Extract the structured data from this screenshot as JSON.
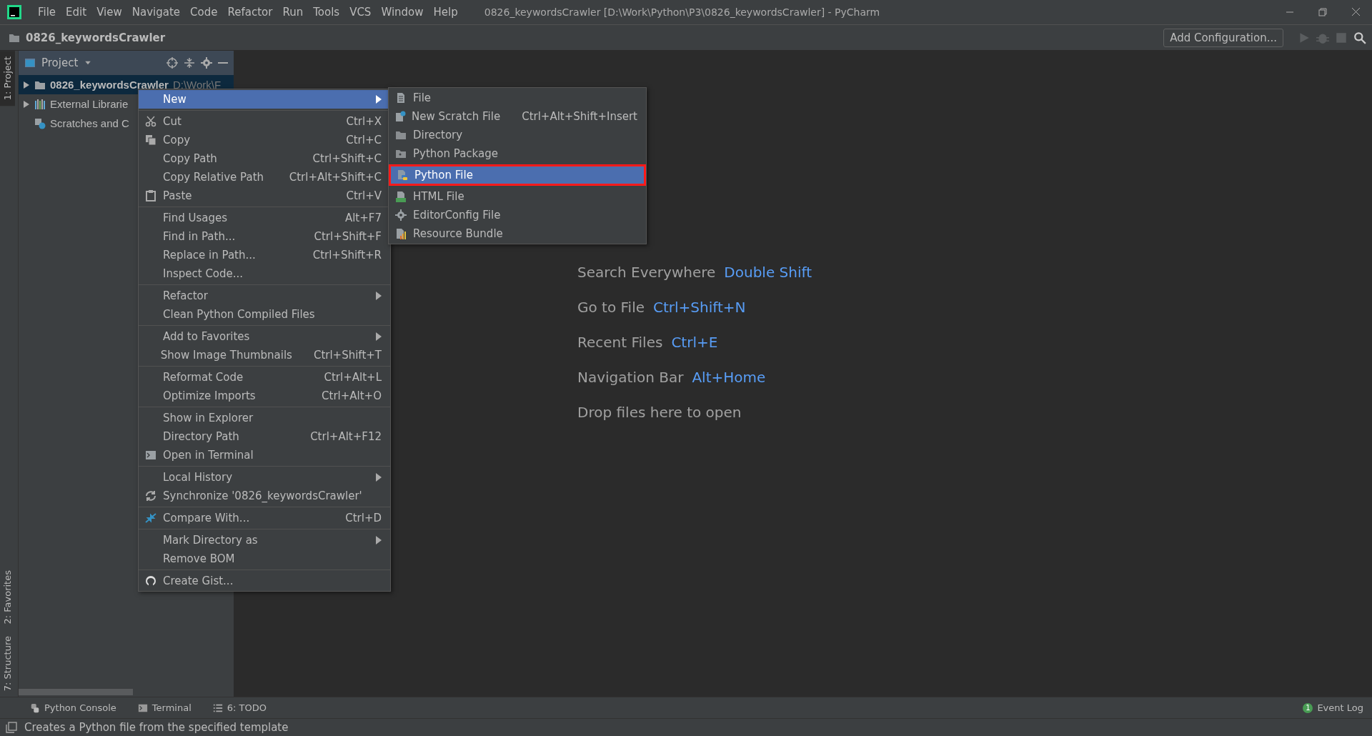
{
  "window": {
    "title": "0826_keywordsCrawler [D:\\Work\\Python\\P3\\0826_keywordsCrawler] - PyCharm"
  },
  "menu_bar": [
    "File",
    "Edit",
    "View",
    "Navigate",
    "Code",
    "Refactor",
    "Run",
    "Tools",
    "VCS",
    "Window",
    "Help"
  ],
  "navigation_bar": {
    "breadcrumb": "0826_keywordsCrawler",
    "run_config": "Add Configuration..."
  },
  "left_tool_strip": [
    {
      "label": "1: Project",
      "selected": true
    },
    {
      "label": "2: Favorites",
      "selected": false
    },
    {
      "label": "7: Structure",
      "selected": false
    }
  ],
  "project_panel": {
    "title": "Project",
    "tree": [
      {
        "label": "0826_keywordsCrawler",
        "path": "D:\\Work\\F",
        "expanded": false,
        "selected": true
      },
      {
        "label": "External Librarie",
        "expanded": false,
        "selected": false
      },
      {
        "label": "Scratches and C",
        "selected": false
      }
    ]
  },
  "context_menu": [
    [
      {
        "label": "New",
        "submenu": true,
        "selected": true
      }
    ],
    [
      {
        "label": "Cut",
        "shortcut": "Ctrl+X",
        "selected": false
      },
      {
        "label": "Copy",
        "shortcut": "Ctrl+C",
        "selected": false
      },
      {
        "label": "Copy Path",
        "shortcut": "Ctrl+Shift+C",
        "selected": false
      },
      {
        "label": "Copy Relative Path",
        "shortcut": "Ctrl+Alt+Shift+C",
        "selected": false
      },
      {
        "label": "Paste",
        "shortcut": "Ctrl+V",
        "selected": false
      }
    ],
    [
      {
        "label": "Find Usages",
        "shortcut": "Alt+F7",
        "selected": false
      },
      {
        "label": "Find in Path...",
        "shortcut": "Ctrl+Shift+F",
        "selected": false
      },
      {
        "label": "Replace in Path...",
        "shortcut": "Ctrl+Shift+R",
        "selected": false
      },
      {
        "label": "Inspect Code...",
        "selected": false
      }
    ],
    [
      {
        "label": "Refactor",
        "submenu": true,
        "selected": false
      },
      {
        "label": "Clean Python Compiled Files",
        "selected": false
      }
    ],
    [
      {
        "label": "Add to Favorites",
        "submenu": true,
        "selected": false
      },
      {
        "label": "Show Image Thumbnails",
        "shortcut": "Ctrl+Shift+T",
        "selected": false
      }
    ],
    [
      {
        "label": "Reformat Code",
        "shortcut": "Ctrl+Alt+L",
        "selected": false
      },
      {
        "label": "Optimize Imports",
        "shortcut": "Ctrl+Alt+O",
        "selected": false
      }
    ],
    [
      {
        "label": "Show in Explorer",
        "selected": false
      },
      {
        "label": "Directory Path",
        "shortcut": "Ctrl+Alt+F12",
        "selected": false
      },
      {
        "label": "Open in Terminal",
        "selected": false
      }
    ],
    [
      {
        "label": "Local History",
        "submenu": true,
        "selected": false
      },
      {
        "label": "Synchronize '0826_keywordsCrawler'",
        "selected": false
      }
    ],
    [
      {
        "label": "Compare With...",
        "shortcut": "Ctrl+D",
        "selected": false
      }
    ],
    [
      {
        "label": "Mark Directory as",
        "submenu": true,
        "selected": false
      },
      {
        "label": "Remove BOM",
        "selected": false
      }
    ],
    [
      {
        "label": "Create Gist...",
        "selected": false
      }
    ]
  ],
  "new_submenu": [
    {
      "label": "File",
      "selected": false
    },
    {
      "label": "New Scratch File",
      "shortcut": "Ctrl+Alt+Shift+Insert",
      "selected": false
    },
    {
      "label": "Directory",
      "selected": false
    },
    {
      "label": "Python Package",
      "selected": false
    },
    {
      "label": "Python File",
      "selected": true
    },
    {
      "label": "HTML File",
      "selected": false
    },
    {
      "label": "EditorConfig File",
      "selected": false
    },
    {
      "label": "Resource Bundle",
      "selected": false
    }
  ],
  "welcome_hints": [
    {
      "label": "Search Everywhere",
      "shortcut": "Double Shift"
    },
    {
      "label": "Go to File",
      "shortcut": "Ctrl+Shift+N"
    },
    {
      "label": "Recent Files",
      "shortcut": "Ctrl+E"
    },
    {
      "label": "Navigation Bar",
      "shortcut": "Alt+Home"
    },
    {
      "label": "Drop files here to open"
    }
  ],
  "bottom_tool_bar": {
    "tabs": [
      "Python Console",
      "Terminal",
      "6: TODO"
    ],
    "event_log": {
      "label": "Event Log",
      "count": "1"
    }
  },
  "status_bar": "Creates a Python file from the specified template"
}
